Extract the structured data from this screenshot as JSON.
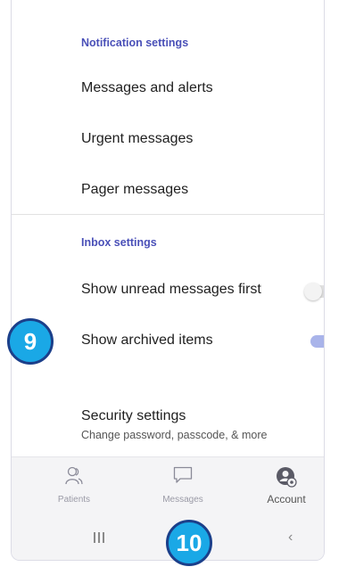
{
  "notification_settings": {
    "header": "Notification settings",
    "items": [
      "Messages and alerts",
      "Urgent messages",
      "Pager messages"
    ]
  },
  "inbox_settings": {
    "header": "Inbox settings",
    "unread_first": {
      "label": "Show unread messages first",
      "enabled": false
    },
    "archived": {
      "label": "Show archived items",
      "enabled": true
    }
  },
  "security_settings": {
    "label": "Security settings",
    "subtitle": "Change password, passcode, & more"
  },
  "bottom_nav": {
    "items": [
      {
        "label": "Patients",
        "icon": "patients-icon"
      },
      {
        "label": "Messages",
        "icon": "messages-icon"
      },
      {
        "label": "Account",
        "icon": "account-icon"
      }
    ]
  },
  "callouts": {
    "first": "9",
    "second": "10"
  },
  "colors": {
    "accent": "#4256c9",
    "section_header": "#4a50b8",
    "callout_fill": "#1aa8e6",
    "callout_border": "#1b3f8a"
  }
}
